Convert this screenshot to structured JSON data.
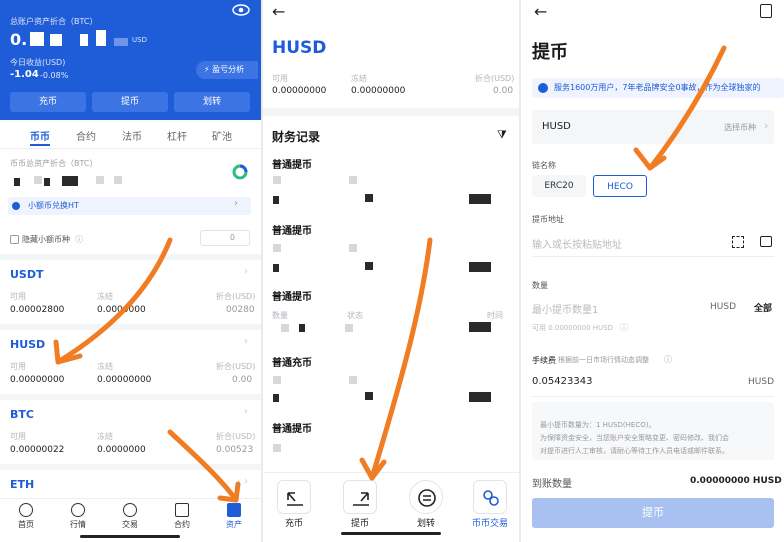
{
  "p1": {
    "total_label": "总账户资产折合（BTC）",
    "total_value": "0.",
    "total_unit": "USD",
    "today_label": "今日收益(USD)",
    "today_value": "-1.04",
    "today_pct": "-0.08%",
    "pnl_button": "盈亏分析",
    "actions": [
      "充币",
      "提币",
      "划转"
    ],
    "tabs": [
      "币币",
      "合约",
      "法币",
      "杠杆",
      "矿池"
    ],
    "coin_total_label": "币币总资产折合（BTC）",
    "convert_label": "小额币兑换HT",
    "hide_small": "隐藏小额币种",
    "col_avail": "可用",
    "col_frozen": "冻结",
    "col_usd": "折合(USD)",
    "coins": [
      {
        "name": "USDT",
        "avail": "0.00002800",
        "frozen": "0.0000000",
        "usd": "00280"
      },
      {
        "name": "HUSD",
        "avail": "0.00000000",
        "frozen": "0.00000000",
        "usd": "0.00"
      },
      {
        "name": "BTC",
        "avail": "0.00000022",
        "frozen": "0.0000000",
        "usd": "0.00523"
      },
      {
        "name": "ETH"
      }
    ],
    "nav": [
      "首页",
      "行情",
      "交易",
      "合约",
      "资产"
    ]
  },
  "p2": {
    "coin": "HUSD",
    "col_avail": "可用",
    "col_frozen": "冻结",
    "col_usd": "折合(USD)",
    "avail": "0.00000000",
    "frozen": "0.00000000",
    "usd": "0.00",
    "records_title": "财务记录",
    "records": [
      "普通提币",
      "普通提币",
      "普通提币",
      "普通充币",
      "普通提币"
    ],
    "rec_cols": [
      "数量",
      "状态",
      "时间"
    ],
    "bottom": [
      "充币",
      "提币",
      "划转",
      "币币交易"
    ]
  },
  "p3": {
    "title": "提币",
    "notice": "服务1600万用户，7年老品牌安全0事故，作为全球独家的",
    "coin": "HUSD",
    "choose_coin": "选择币种",
    "chain_label": "链名称",
    "chains": [
      "ERC20",
      "HECO"
    ],
    "addr_label": "提币地址",
    "addr_placeholder": "输入或长按粘贴地址",
    "qty_label": "数量",
    "qty_placeholder": "最小提币数量1",
    "qty_unit": "HUSD",
    "all_label": "全部",
    "avail_line": "可用 0.00000000 HUSD",
    "fee_label": "手续费",
    "fee_hint": "根据前一日市场行情动态调整",
    "fee_value": "0.05423343",
    "fee_unit": "HUSD",
    "tip1": "最小提币数量为：1 HUSD(HECO)。",
    "tip2": "为保障资金安全，当您账户安全策略变更、密码修改、我们会",
    "tip3": "对提币进行人工审核，请耐心等待工作人员电话或邮件联系。",
    "receive_label": "到账数量",
    "receive_value": "0.00000000 HUSD",
    "submit": "提币"
  }
}
